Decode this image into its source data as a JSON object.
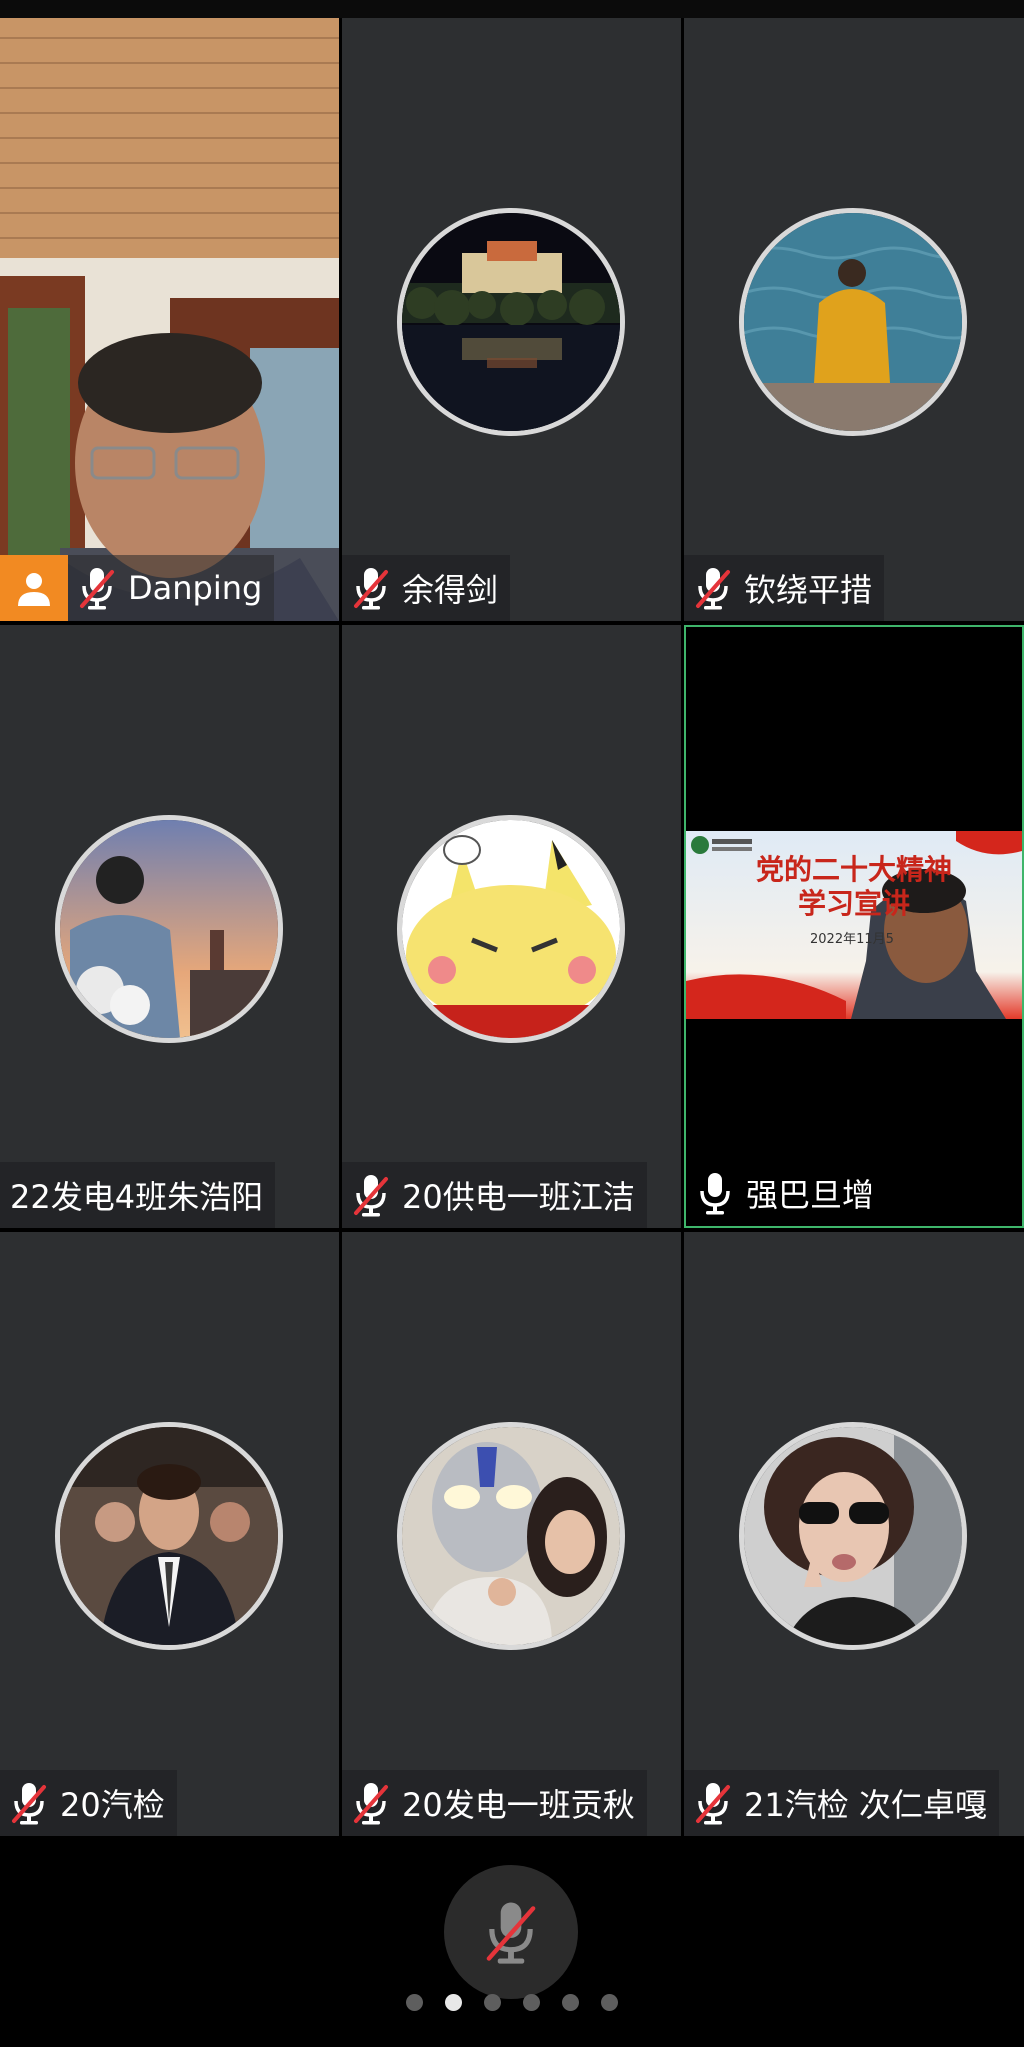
{
  "participants": [
    {
      "name": "Danping",
      "mic": "muted",
      "video": true
    },
    {
      "name": "余得剑",
      "mic": "muted",
      "avatar": "potala-palace-night-photo"
    },
    {
      "name": "钦绕平措",
      "mic": "muted",
      "avatar": "person-by-sea-photo"
    },
    {
      "name": "22发电4班朱浩阳",
      "mic": "none",
      "avatar": "man-with-bouquet-photo"
    },
    {
      "name": "20供电一班江洁",
      "mic": "muted",
      "avatar": "pikachu-sticker"
    },
    {
      "name": "强巴旦增",
      "mic": "on",
      "video": true,
      "active_speaker": true
    },
    {
      "name": "20汽检",
      "mic": "muted",
      "avatar": "man-in-suit-photo"
    },
    {
      "name": "20发电一班贡秋",
      "mic": "muted",
      "avatar": "ultraman-selfie-photo"
    },
    {
      "name": "21汽检 次仁卓嘎",
      "mic": "muted",
      "avatar": "woman-sunglasses-photo"
    }
  ],
  "shared_slide": {
    "title_line1": "党的二十大精神",
    "title_line2": "学习宣讲",
    "date": "2022年11月5"
  },
  "bottom_bar": {
    "mic_button_icon": "mic-muted-icon",
    "pages": 6,
    "current_page_index": 1
  },
  "colors": {
    "tile_bg": "#2d2f31",
    "active_border": "#3fb56b",
    "muted_slash": "#e5343a",
    "host_badge": "#f28a22"
  }
}
